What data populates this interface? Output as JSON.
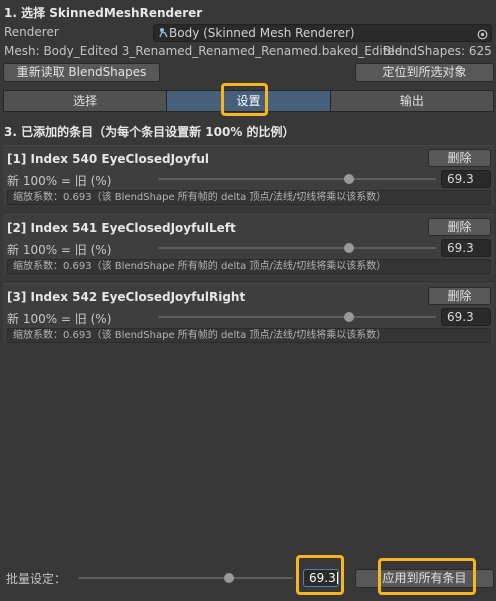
{
  "section1": {
    "title": "1. 选择 SkinnedMeshRenderer",
    "renderer_label": "Renderer",
    "renderer_value": "Body (Skinned Mesh Renderer)",
    "mesh_info": "Mesh: Body_Edited 3_Renamed_Renamed_Renamed.baked_Edited",
    "blendshapes_info": "BlendShapes: 625",
    "reload_button": "重新读取 BlendShapes",
    "locate_button": "定位到所选对象"
  },
  "tabs": [
    "选择",
    "设置",
    "输出"
  ],
  "section3": {
    "title": "3. 已添加的条目（为每个条目设置新 100% 的比例）"
  },
  "entries": [
    {
      "title": "[1]  Index 540  EyeClosedJoyful",
      "delete_label": "删除",
      "ratio_label": "新 100% = 旧 (%)",
      "value": "69.3",
      "slider_fraction": 0.693,
      "note": "缩放系数：0.693（该 BlendShape 所有帧的 delta 顶点/法线/切线将乘以该系数）"
    },
    {
      "title": "[2]  Index 541  EyeClosedJoyfulLeft",
      "delete_label": "删除",
      "ratio_label": "新 100% = 旧 (%)",
      "value": "69.3",
      "slider_fraction": 0.693,
      "note": "缩放系数：0.693（该 BlendShape 所有帧的 delta 顶点/法线/切线将乘以该系数）"
    },
    {
      "title": "[3]  Index 542  EyeClosedJoyfulRight",
      "delete_label": "删除",
      "ratio_label": "新 100% = 旧 (%)",
      "value": "69.3",
      "slider_fraction": 0.693,
      "note": "缩放系数：0.693（该 BlendShape 所有帧的 delta 顶点/法线/切线将乘以该系数）"
    }
  ],
  "batch": {
    "label": "批量设定：",
    "value": "69.3",
    "slider_fraction": 0.693,
    "apply_button": "应用到所有条目"
  },
  "colors": {
    "highlight": "#f7b521",
    "active_tab": "#46607c"
  },
  "icons": {
    "renderer_icon": "skinned-mesh-icon",
    "picker_icon": "object-picker-icon"
  }
}
